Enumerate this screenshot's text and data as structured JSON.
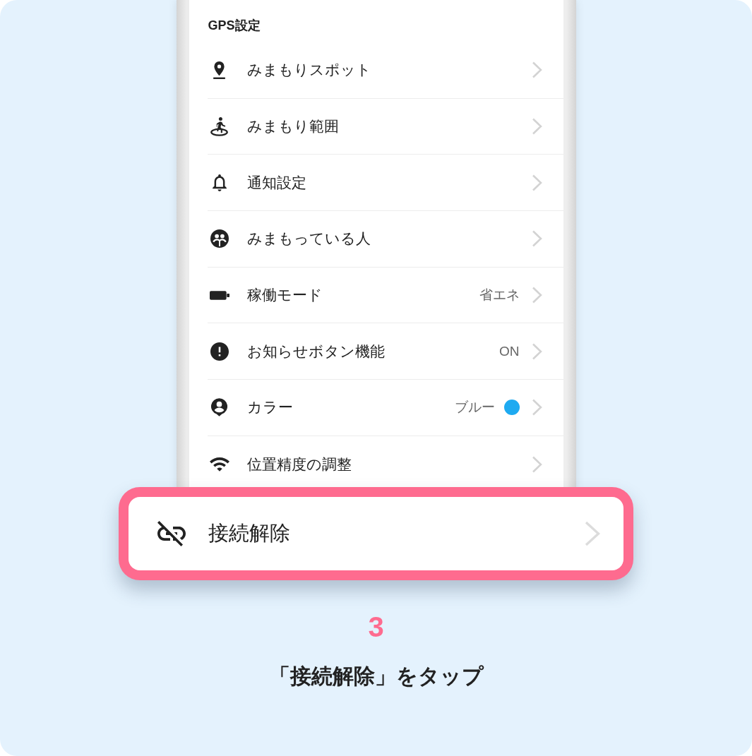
{
  "section_title": "GPS設定",
  "settings": [
    {
      "kind": "spot",
      "label": "みまもりスポット"
    },
    {
      "kind": "range",
      "label": "みまもり範囲"
    },
    {
      "kind": "notification",
      "label": "通知設定"
    },
    {
      "kind": "watchers",
      "label": "みまもっている人"
    },
    {
      "kind": "mode",
      "label": "稼働モード",
      "value": "省エネ"
    },
    {
      "kind": "alert_button",
      "label": "お知らせボタン機能",
      "value": "ON"
    },
    {
      "kind": "color",
      "label": "カラー",
      "value": "ブルー",
      "color": "#1eaaf1"
    },
    {
      "kind": "accuracy",
      "label": "位置精度の調整"
    }
  ],
  "highlighted_item": {
    "kind": "disconnect",
    "label": "接続解除"
  },
  "step": {
    "number": "3",
    "caption": "「接続解除」をタップ"
  }
}
